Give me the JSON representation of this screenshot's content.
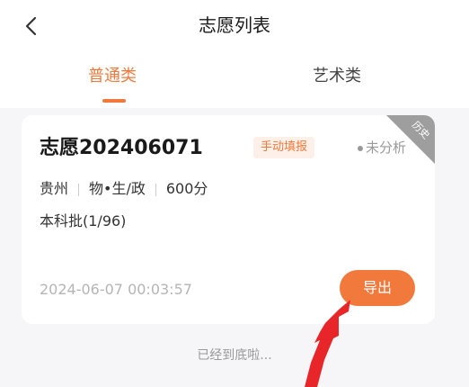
{
  "nav": {
    "title": "志愿列表",
    "back_icon": "chevron-left-icon"
  },
  "tabs": [
    {
      "label": "普通类",
      "active": true
    },
    {
      "label": "艺术类",
      "active": false
    }
  ],
  "card": {
    "title": "志愿202406071",
    "tag": "手动填报",
    "status": "未分析",
    "corner_label": "历史",
    "province": "贵州",
    "subjects": "物•生/政",
    "score": "600分",
    "batch": "本科批(1/96)",
    "timestamp": "2024-06-07 00:03:57",
    "export_label": "导出"
  },
  "footer": {
    "text": "已经到底啦..."
  },
  "colors": {
    "accent": "#f07a3c",
    "annotation_arrow": "#e8262a",
    "corner_ribbon": "#9e9e9e"
  }
}
